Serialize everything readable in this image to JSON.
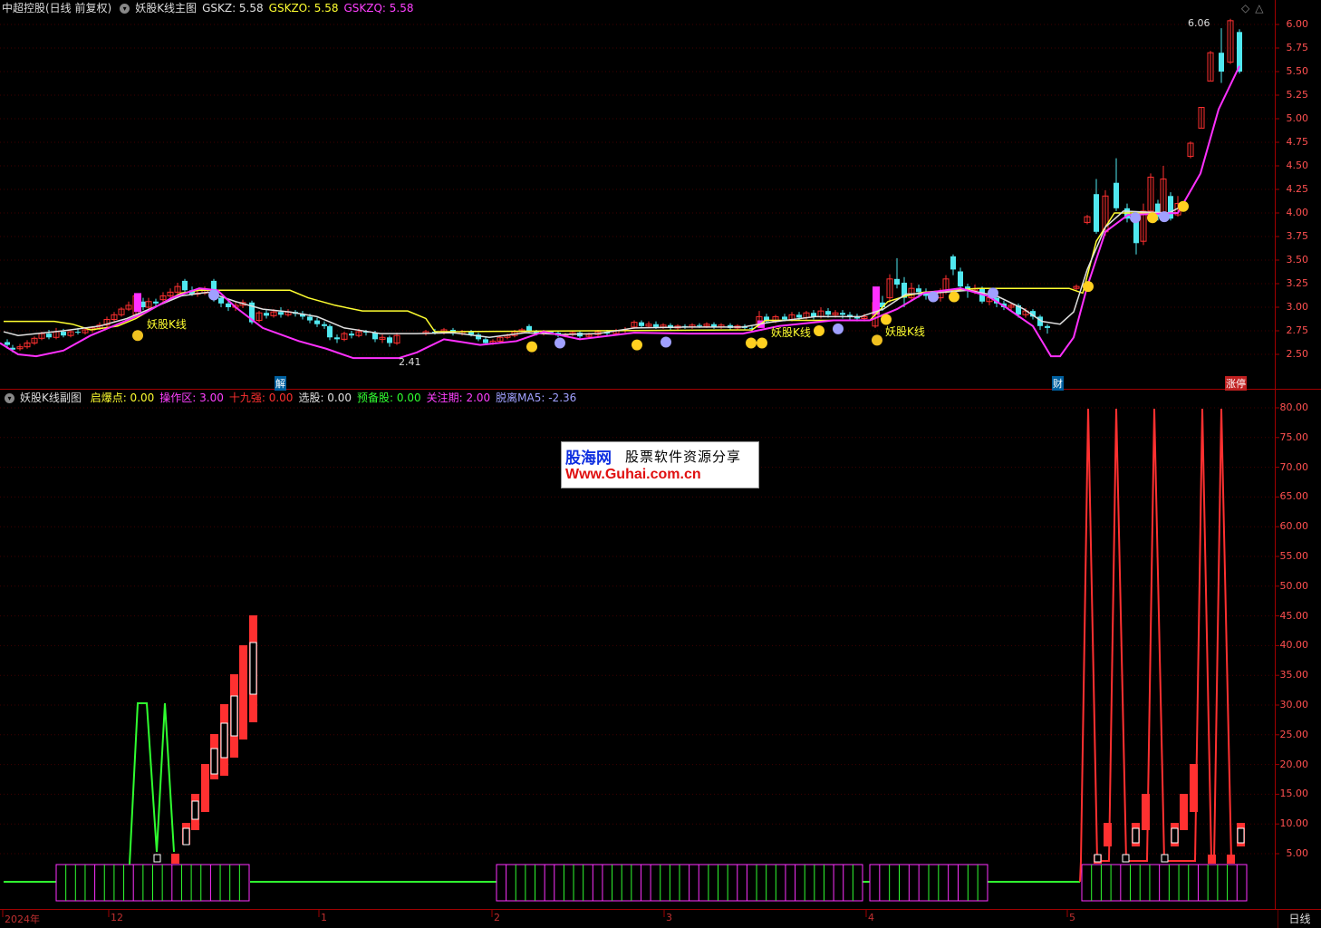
{
  "main_header": {
    "stock": "中超控股(日线 前复权)",
    "indicator": "妖股K线主图",
    "gskz": "GSKZ: 5.58",
    "gskzo": "GSKZO: 5.58",
    "gskzq": "GSKZQ: 5.58",
    "colors": {
      "gskz": "#e0e0e0",
      "gskzo": "#ffff30",
      "gskzq": "#ff40ff"
    }
  },
  "sub_header": {
    "indicator": "妖股K线副图",
    "items": [
      {
        "label": "启爆点: 0.00",
        "color": "#ffff30"
      },
      {
        "label": "操作区: 3.00",
        "color": "#ff40ff"
      },
      {
        "label": "十九强: 0.00",
        "color": "#ff3030"
      },
      {
        "label": "选股: 0.00",
        "color": "#e0e0e0"
      },
      {
        "label": "预备股: 0.00",
        "color": "#30ff30"
      },
      {
        "label": "关注期: 2.00",
        "color": "#ff40ff"
      },
      {
        "label": "脱离MA5: -2.36",
        "color": "#a0a0ff"
      }
    ]
  },
  "price_axis": [
    "6.00",
    "5.75",
    "5.50",
    "5.25",
    "5.00",
    "4.75",
    "4.50",
    "4.25",
    "4.00",
    "3.75",
    "3.50",
    "3.25",
    "3.00",
    "2.75",
    "2.50"
  ],
  "sub_axis": [
    "80.00",
    "75.00",
    "70.00",
    "65.00",
    "60.00",
    "55.00",
    "50.00",
    "45.00",
    "40.00",
    "35.00",
    "30.00",
    "25.00",
    "20.00",
    "15.00",
    "10.00",
    "5.00"
  ],
  "dates": [
    "2024年",
    "12",
    "1",
    "2",
    "3",
    "4",
    "5"
  ],
  "annotations": {
    "high": "6.06",
    "low": "2.41",
    "signal_label": "妖股K线",
    "jie": "解",
    "cai": "财",
    "zhangting": "涨停"
  },
  "watermark": {
    "brand": "股海网",
    "slogan": "股票软件资源分享",
    "url": "Www.Guhai.com.cn"
  },
  "period": "日线",
  "colors": {
    "up": "#ff3030",
    "down": "#50e8f0",
    "ma_white": "#e0e0e0",
    "ma_yellow": "#ffff30",
    "ma_magenta": "#ff30ff",
    "green": "#30ff30"
  }
}
